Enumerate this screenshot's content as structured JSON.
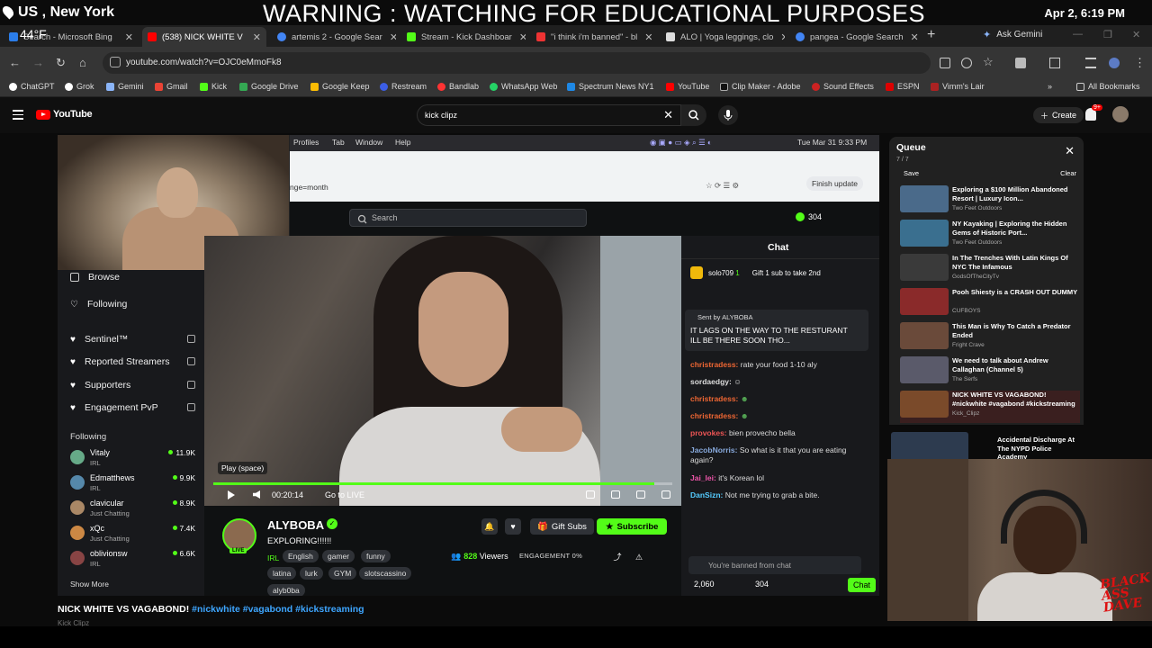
{
  "overlay": {
    "location": "US , New York",
    "temperature": "44°F",
    "warning": "WARNING : WATCHING FOR EDUCATIONAL PURPOSES",
    "datetime": "Apr 2, 6:19 PM"
  },
  "tabs": [
    {
      "label": "Search - Microsoft Bing",
      "color": "#2b7de9"
    },
    {
      "label": "(538) NICK WHITE V",
      "color": "#ff0000",
      "active": true
    },
    {
      "label": "artemis 2 - Google Sear",
      "color": "#4285f4"
    },
    {
      "label": "Stream - Kick Dashboar",
      "color": "#53fc18"
    },
    {
      "label": "\"i think i'm banned\" - bl",
      "color": "#e33"
    },
    {
      "label": "ALO | Yoga leggings, clo",
      "color": "#ddd"
    },
    {
      "label": "pangea - Google Search",
      "color": "#4285f4"
    }
  ],
  "toolbar": {
    "new_tab": "+",
    "ask_gemini": "Ask Gemini",
    "url": "youtube.com/watch?v=OJC0eMmoFk8"
  },
  "bookmarks": [
    {
      "label": "ChatGPT",
      "color": "#fff"
    },
    {
      "label": "Grok",
      "color": "#fff"
    },
    {
      "label": "Gemini",
      "color": "#8ab4f8"
    },
    {
      "label": "Gmail",
      "color": "#ea4335"
    },
    {
      "label": "Kick",
      "color": "#53fc18"
    },
    {
      "label": "Google Drive",
      "color": "#34a853"
    },
    {
      "label": "Google Keep",
      "color": "#fbbc04"
    },
    {
      "label": "Restream",
      "color": "#3c5ee6"
    },
    {
      "label": "Bandlab",
      "color": "#f33"
    },
    {
      "label": "WhatsApp Web",
      "color": "#25d366"
    },
    {
      "label": "Spectrum News NY1",
      "color": "#1e88e5"
    },
    {
      "label": "YouTube",
      "color": "#ff0000"
    },
    {
      "label": "Clip Maker - Adobe",
      "color": "#222"
    },
    {
      "label": "Sound Effects",
      "color": "#c22"
    },
    {
      "label": "ESPN",
      "color": "#d00"
    },
    {
      "label": "Vimm's Lair",
      "color": "#a22"
    }
  ],
  "bookmarks_all": "All Bookmarks",
  "youtube": {
    "logo": "YouTube",
    "search_query": "kick clipz",
    "create": "Create",
    "notif_count": "9+"
  },
  "recording": {
    "menus": [
      "Profiles",
      "Tab",
      "Window",
      "Help"
    ],
    "clock": "Tue Mar 31  9:33 PM",
    "url_fragment": "nge=month",
    "finish_update": "Finish update",
    "search_placeholder": "Search",
    "coins": "304"
  },
  "kick_sidebar": {
    "nav": [
      {
        "label": "Browse"
      },
      {
        "label": "Following"
      }
    ],
    "pinned": [
      {
        "label": "Sentinel™"
      },
      {
        "label": "Reported Streamers"
      },
      {
        "label": "Supporters"
      },
      {
        "label": "Engagement PvP"
      }
    ],
    "following_header": "Following",
    "streamers": [
      {
        "name": "Vitaly",
        "category": "IRL",
        "viewers": "11.9K",
        "color": "#6a8"
      },
      {
        "name": "Edmatthews",
        "category": "IRL",
        "viewers": "9.9K",
        "color": "#58a"
      },
      {
        "name": "clavicular",
        "category": "Just Chatting",
        "viewers": "8.9K",
        "color": "#a86"
      },
      {
        "name": "xQc",
        "category": "Just Chatting",
        "viewers": "7.4K",
        "color": "#c84"
      },
      {
        "name": "oblivionsw",
        "category": "IRL",
        "viewers": "6.6K",
        "color": "#844"
      }
    ],
    "show_more": "Show More"
  },
  "player": {
    "tooltip": "Play (space)",
    "time": "00:20:14",
    "go_live": "Go to LIVE",
    "progress": 0.96
  },
  "stream_info": {
    "name": "ALYBOBA",
    "live": "LIVE",
    "title": "EXPLORING!!!!!!",
    "category": "IRL",
    "tags": [
      "English",
      "gamer",
      "funny",
      "latina",
      "lurk",
      "GYM",
      "slotscassino"
    ],
    "viewers": "828",
    "viewers_label": "Viewers",
    "engagement": "ENGAGEMENT",
    "engagement_value": "0%",
    "gift_subs": "Gift Subs",
    "subscribe": "Subscribe",
    "username": "alyb0ba"
  },
  "chat": {
    "header": "Chat",
    "top_gifter": "solo709",
    "top_gifter_count": "1",
    "gift_prompt": "Gift 1 sub to take 2nd",
    "pinned_by": "Sent by  ALYBOBA",
    "pinned_msg": "IT LAGS ON THE WAY TO THE RESTURANT ILL BE THERE SOON THO...",
    "lines": [
      {
        "user": "christradess:",
        "text": "rate your food 1-10 aly",
        "color": "#e63"
      },
      {
        "user": "sordaedgy:",
        "text": "",
        "color": "#ddd"
      },
      {
        "user": "christradess:",
        "text": "",
        "color": "#e63"
      },
      {
        "user": "christradess:",
        "text": "",
        "color": "#e63"
      },
      {
        "user": "provokes:",
        "text": "bien provecho bella",
        "color": "#e55"
      },
      {
        "user": "JacobNorris:",
        "text": "So what is it that you are eating again?",
        "color": "#8ad"
      },
      {
        "user": "Jai_lei:",
        "text": "it's Korean lol",
        "color": "#e5a"
      },
      {
        "user": "DanSizn:",
        "text": "Not me trying to grab a bite.",
        "color": "#5cf"
      }
    ],
    "banned": "You're banned from chat",
    "points": "2,060",
    "chat_coins": "304",
    "send": "Chat"
  },
  "video": {
    "title_plain": "NICK WHITE VS VAGABOND!",
    "hashtags": "#nickwhite #vagabond #kickstreaming",
    "channel": "Kick Clipz"
  },
  "queue": {
    "title": "Queue",
    "count": "7 / 7",
    "save": "Save",
    "clear": "Clear",
    "items": [
      {
        "title": "Exploring a $100 Million Abandoned Resort | Luxury Icon...",
        "channel": "Two Feet Outdoors",
        "color": "#4a6a8a"
      },
      {
        "title": "NY Kayaking | Exploring the Hidden Gems of Historic Port...",
        "channel": "Two Feet Outdoors",
        "color": "#3a6f8f"
      },
      {
        "title": "In The Trenches With Latin Kings Of NYC The Infamous",
        "channel": "GodsOfTheCityTv",
        "color": "#3a3a3a"
      },
      {
        "title": "Pooh Shiesty is a CRASH OUT DUMMY",
        "channel": "CUFBOYS",
        "color": "#8a2a2a"
      },
      {
        "title": "This Man is Why To Catch a Predator Ended",
        "channel": "Fright Crave",
        "color": "#6a4a3a"
      },
      {
        "title": "We need to talk about Andrew Callaghan (Channel 5)",
        "channel": "The Serfs",
        "color": "#5a5a6a"
      },
      {
        "title": "NICK WHITE VS VAGABOND! #nickwhite #vagabond #kickstreaming",
        "channel": "Kick_Clipz",
        "color": "#7a4a2a"
      }
    ]
  },
  "recommended": {
    "title": "Accidental Discharge At The NYPD Police Academy"
  },
  "facecam": {
    "logo": "BLACK ASS DAVE"
  }
}
